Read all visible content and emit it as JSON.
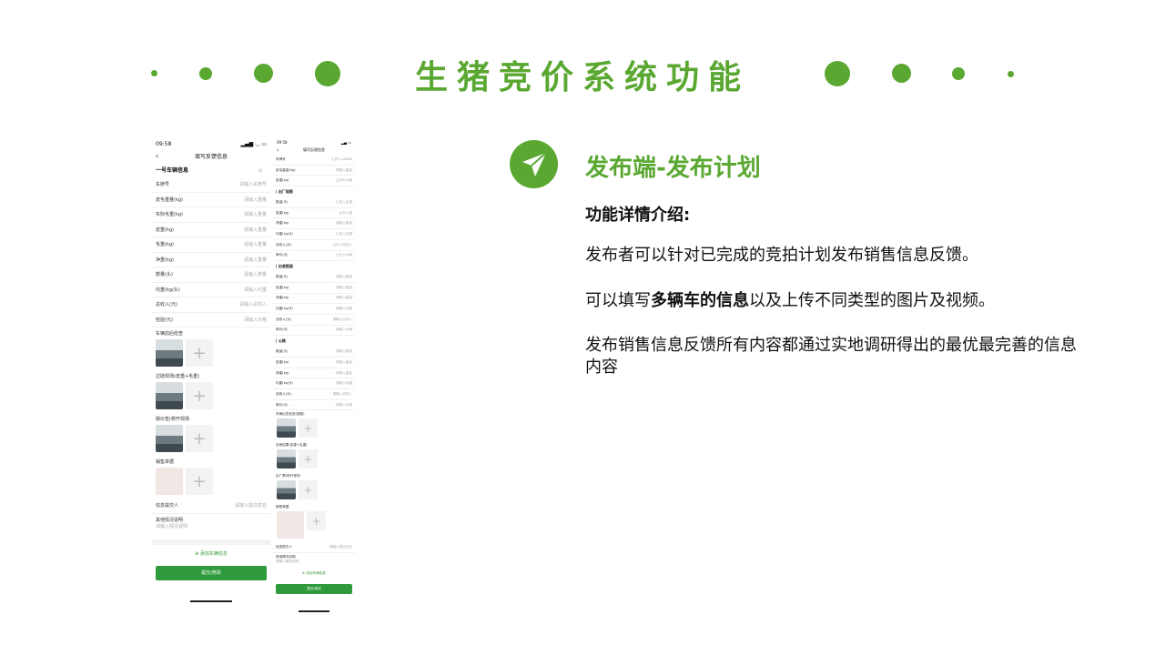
{
  "colors": {
    "accent": "#5aa832",
    "button": "#2f9a3c"
  },
  "title": "生猪竞价系统功能",
  "phone1": {
    "time": "09:58",
    "nav_title": "填写反馈信息",
    "section": "一号车辆信息",
    "rows": [
      {
        "label": "车牌号",
        "ph": "请输入车牌号"
      },
      {
        "label": "皮毛重量(kg)",
        "ph": "请输入重量"
      },
      {
        "label": "实际毛重(kg)",
        "ph": "请输入重量"
      },
      {
        "label": "皮重(kg)",
        "ph": "请输入重量"
      },
      {
        "label": "毛重(kg)",
        "ph": "请输入重量"
      },
      {
        "label": "净重(kg)",
        "ph": "请输入重量"
      },
      {
        "label": "数量(头)",
        "ph": "请输入数量"
      },
      {
        "label": "均重(kg/头)",
        "ph": "请输入均重"
      },
      {
        "label": "总收入(元)",
        "ph": "请输入总收入"
      },
      {
        "label": "检验(元)",
        "ph": "请输入价格"
      }
    ],
    "uploads": [
      "车辆前后检查",
      "过磅现场(皮重+毛重)",
      "磅价签(称开现场",
      "销售单据"
    ],
    "submitter": {
      "label": "信息提交人",
      "ph": "请输入提交姓名"
    },
    "other": {
      "label": "其他情况说明",
      "ph": "请输入情况说明"
    },
    "add_car": "添加车辆信息",
    "submit": "提交/修改"
  },
  "phone2": {
    "time": "09:58",
    "nav_title": "填写反馈信息",
    "top_rows": [
      {
        "label": "车牌号",
        "ph": "山东H AA888"
      },
      {
        "label": "皮毛重量(kg)",
        "ph": "请输入重量"
      },
      {
        "label": "皮重(kg)",
        "ph": "山东HAA重"
      }
    ],
    "sections": [
      {
        "title": "| 出厂现报",
        "rows": [
          {
            "label": "数量(头)",
            "ph": "山东入出重"
          },
          {
            "label": "皮重(kg)",
            "ph": "山东入重"
          },
          {
            "label": "净重(kg)",
            "ph": "请输入重量"
          },
          {
            "label": "均重(kg/头)",
            "ph": "山东入均重"
          },
          {
            "label": "总收入(元)",
            "ph": "山东入总收入"
          },
          {
            "label": "单价(元)",
            "ph": "山东入价格"
          }
        ]
      },
      {
        "title": "| 出收报道",
        "rows": [
          {
            "label": "数量(头)",
            "ph": "请输入数量"
          },
          {
            "label": "皮重(kg)",
            "ph": "请输入重量"
          },
          {
            "label": "净重(kg)",
            "ph": "请输入重量"
          },
          {
            "label": "均重(kg/头)",
            "ph": "请输入均重"
          },
          {
            "label": "总收入(元)",
            "ph": "请输入总收入"
          },
          {
            "label": "单价(元)",
            "ph": "请输入价格"
          }
        ]
      },
      {
        "title": "| 公路",
        "rows": [
          {
            "label": "数量(头)",
            "ph": "请输入数量"
          },
          {
            "label": "皮重(kg)",
            "ph": "请输入重量"
          },
          {
            "label": "净重(kg)",
            "ph": "请输入重量"
          },
          {
            "label": "均重(kg/头)",
            "ph": "请输入均重"
          },
          {
            "label": "总收入(元)",
            "ph": "请输入总收入"
          },
          {
            "label": "单价(元)",
            "ph": "请输入价格"
          }
        ]
      }
    ],
    "uploads": [
      "车辆出发检查(视频)",
      "出磅结果(皮重+毛重)",
      "出厂票(称开现场",
      "销售单据"
    ],
    "submitter": {
      "label": "信息提交人",
      "ph": "请输入提交姓名"
    },
    "other": {
      "label": "其他情况说明",
      "ph": "请输入情况说明"
    },
    "add_car": "添加车辆信息",
    "submit": "提交/修改"
  },
  "panel": {
    "heading": "发布端-发布计划",
    "intro_label": "功能详情介绍:",
    "p1": "发布者可以针对已完成的竞拍计划发布销售信息反馈。",
    "p2_pre": "可以填写",
    "p2_bold": "多辆车的信息",
    "p2_post": "以及上传不同类型的图片及视频。",
    "p3": "发布销售信息反馈所有内容都通过实地调研得出的最优最完善的信息内容"
  }
}
